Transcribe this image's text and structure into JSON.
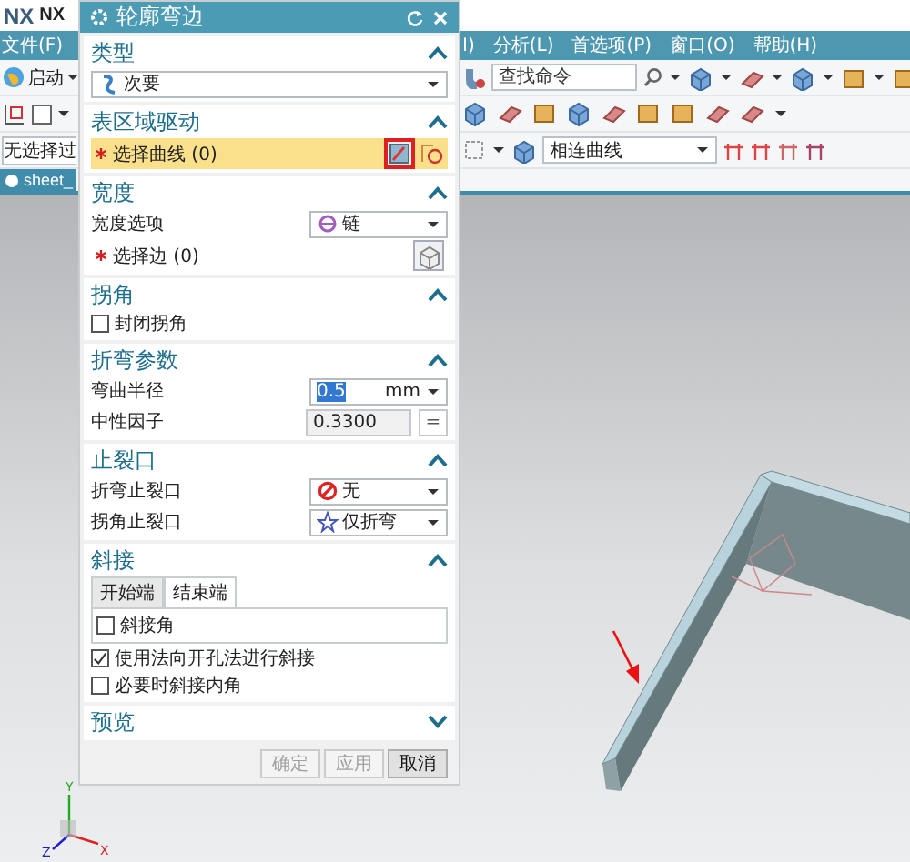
{
  "app": {
    "logo": "NX",
    "tab": "NX",
    "menus_left": [
      "文件(F)"
    ],
    "menus_right": [
      "I)",
      "分析(L)",
      "首选项(P)",
      "窗口(O)",
      "帮助(H)"
    ],
    "start": "启动",
    "search": {
      "placeholder": "查找命令"
    },
    "filter": "无选择过",
    "curve_rule": "相连曲线",
    "part_tab": "sheet_",
    "axes": [
      "Y",
      "X",
      "Z"
    ]
  },
  "dialog": {
    "title": "轮廓弯边",
    "sections": [
      {
        "title": "类型",
        "expanded": true,
        "rows": [
          {
            "kind": "dropdown",
            "value": "次要"
          }
        ]
      },
      {
        "title": "表区域驱动",
        "expanded": true,
        "rows": [
          {
            "kind": "curve_selection",
            "label": "选择曲线 (0)",
            "required": true,
            "active": true
          }
        ]
      },
      {
        "title": "宽度",
        "expanded": true,
        "rows": [
          {
            "kind": "dropdown",
            "label": "宽度选项",
            "value": "链"
          },
          {
            "kind": "edge_selection",
            "label": "选择边 (0)",
            "required": true,
            "active": false
          }
        ]
      },
      {
        "title": "拐角",
        "expanded": true,
        "rows": [
          {
            "kind": "checkbox",
            "label": "封闭拐角",
            "checked": false
          }
        ]
      },
      {
        "title": "折弯参数",
        "expanded": true,
        "rows": [
          {
            "kind": "number",
            "label": "弯曲半径",
            "value": "0.5",
            "unit": "mm",
            "highlighted": true
          },
          {
            "kind": "expression",
            "label": "中性因子",
            "value": "0.3300",
            "sign": "="
          }
        ]
      },
      {
        "title": "止裂口",
        "expanded": true,
        "rows": [
          {
            "kind": "dropdown",
            "label": "折弯止裂口",
            "value": "无"
          },
          {
            "kind": "dropdown",
            "label": "拐角止裂口",
            "value": "仅折弯"
          }
        ]
      },
      {
        "title": "斜接",
        "expanded": true,
        "rows": [
          {
            "kind": "tabs",
            "tabs": [
              {
                "label": "开始端",
                "selected": false
              },
              {
                "label": "结束端",
                "selected": true
              }
            ],
            "options": [
              {
                "label": "斜接角",
                "checked": false
              }
            ]
          },
          {
            "kind": "checkbox",
            "label": "使用法向开孔法进行斜接",
            "checked": true
          },
          {
            "kind": "checkbox",
            "label": "必要时斜接内角",
            "checked": false
          }
        ]
      },
      {
        "title": "预览",
        "expanded": false
      }
    ],
    "buttons": [
      {
        "label": "确定",
        "disabled": true
      },
      {
        "label": "应用",
        "disabled": true
      },
      {
        "label": "取消",
        "disabled": false
      }
    ]
  }
}
